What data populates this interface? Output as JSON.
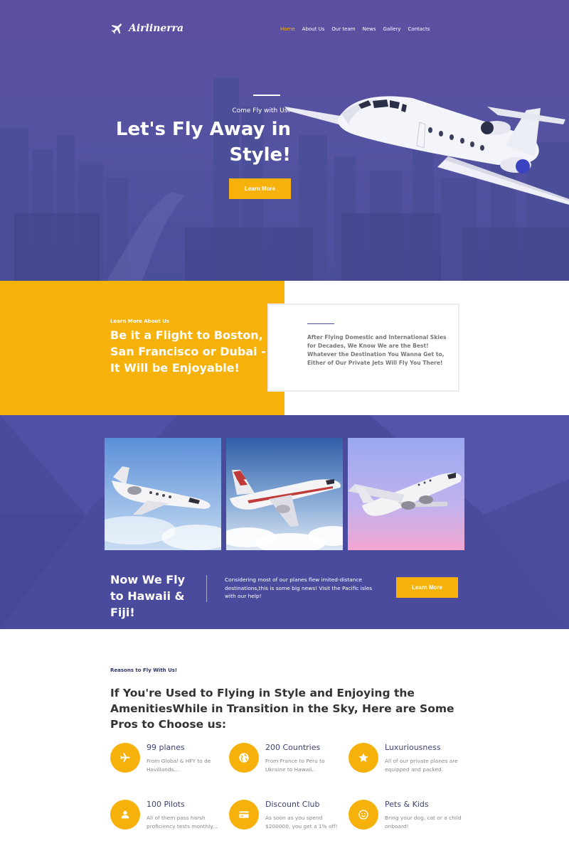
{
  "header": {
    "brand": "Airlinerra",
    "nav": [
      {
        "label": "Home",
        "active": true
      },
      {
        "label": "About Us"
      },
      {
        "label": "Our team"
      },
      {
        "label": "News"
      },
      {
        "label": "Gallery"
      },
      {
        "label": "Contacts"
      }
    ]
  },
  "hero": {
    "kicker": "Come Fly with Us!",
    "title": "Let's Fly Away in Style!",
    "button": "Learn More"
  },
  "about": {
    "kicker": "Learn More About Us",
    "title": "Be it a Flight to Boston, San Francisco or Dubai - It Will be Enjoyable!",
    "text": "After Flying Domestic and International Skies for Decades, We Know We are the Best! Whatever the Destination You Wanna Get to, Either of Our Private Jets Will Fly You There!"
  },
  "fleet": {
    "title": "Now We Fly to Hawaii & Fiji!",
    "text": "Considering most of our planes flew imited-distance destinations,this is some big news! Visit the Pacific isles with our help!",
    "button": "Learn More"
  },
  "reasons": {
    "kicker": "Reasons to Fly With Us!",
    "title": "If You're Used to Flying in Style and Enjoying the AmenitiesWhile in Transition in the Sky, Here are Some Pros to Choose us:",
    "features": [
      {
        "title": "99 planes",
        "text": "From Global & HFY to de Havillands...",
        "icon": "plane-icon"
      },
      {
        "title": "200 Countries",
        "text": "From France to Peru to Ukraine to Hawaii..",
        "icon": "globe-icon"
      },
      {
        "title": "Luxuriousness",
        "text": "All of our private planes are equipped and packed.",
        "icon": "star-icon"
      },
      {
        "title": "100 Pilots",
        "text": "All of them pass harsh proficiency tests monthly...",
        "icon": "person-icon"
      },
      {
        "title": "Discount Club",
        "text": "As soon as you spend $200000, you get a 1% off!",
        "icon": "card-icon"
      },
      {
        "title": "Pets & Kids",
        "text": "Bring your dog, cat or a child onboard!",
        "icon": "smile-icon"
      }
    ]
  },
  "colors": {
    "accent": "#f6b10a",
    "purple": "#4b4b9d",
    "heading": "#3d4276"
  }
}
